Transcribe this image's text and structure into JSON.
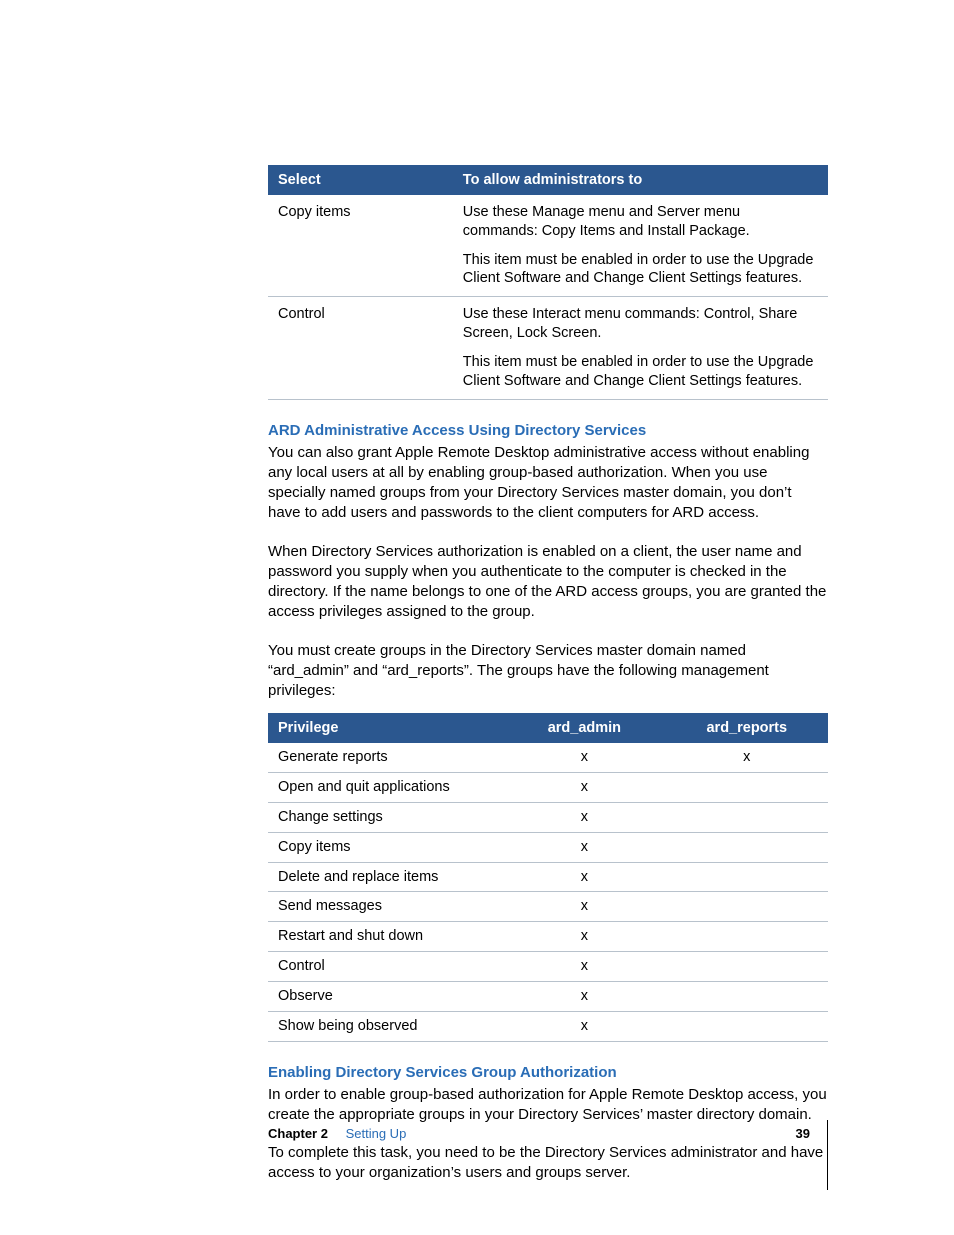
{
  "table1": {
    "head": {
      "c1": "Select",
      "c2": "To allow administrators to"
    },
    "rows": [
      {
        "c1": "Copy items",
        "lines": [
          "Use these Manage menu and Server menu commands:  Copy Items and Install Package.",
          "This item must be enabled in order to use the Upgrade Client Software and Change Client Settings features."
        ]
      },
      {
        "c1": "Control",
        "lines": [
          "Use these Interact menu commands:  Control, Share Screen, Lock Screen.",
          "This item must be enabled in order to use the Upgrade Client Software and Change Client Settings features."
        ]
      }
    ]
  },
  "heading1": "ARD Administrative Access Using Directory Services",
  "para1": "You can also grant Apple Remote Desktop administrative access without enabling any local users at all by enabling group-based authorization. When you use specially named groups from your Directory Services master domain, you don’t have to add users and passwords to the client computers for ARD access.",
  "para2": "When Directory Services authorization is enabled on a client, the user name and password you supply when you authenticate to the computer is checked in the directory. If the name belongs to one of the ARD access groups, you are granted the access privileges assigned to the group.",
  "para3": "You must create groups in the Directory Services master domain named “ard_admin” and “ard_reports”. The groups have the following management privileges:",
  "table2": {
    "head": {
      "c1": "Privilege",
      "c2": "ard_admin",
      "c3": "ard_reports"
    },
    "rows": [
      {
        "p": "Generate reports",
        "a": "x",
        "r": "x"
      },
      {
        "p": "Open and quit applications",
        "a": "x",
        "r": ""
      },
      {
        "p": "Change settings",
        "a": "x",
        "r": ""
      },
      {
        "p": "Copy items",
        "a": "x",
        "r": ""
      },
      {
        "p": "Delete and replace items",
        "a": "x",
        "r": ""
      },
      {
        "p": "Send messages",
        "a": "x",
        "r": ""
      },
      {
        "p": "Restart and shut down",
        "a": "x",
        "r": ""
      },
      {
        "p": "Control",
        "a": "x",
        "r": ""
      },
      {
        "p": "Observe",
        "a": "x",
        "r": ""
      },
      {
        "p": "Show being observed",
        "a": "x",
        "r": ""
      }
    ]
  },
  "heading2": "Enabling Directory Services Group Authorization",
  "para4": "In order to enable group-based authorization for Apple Remote Desktop access, you create the appropriate groups in your Directory Services’ master directory domain.",
  "para5": "To complete this task, you need to be the Directory Services administrator and have access to your organization’s users and groups server.",
  "footer": {
    "chapter": "Chapter 2",
    "title": "Setting Up",
    "page": "39"
  }
}
